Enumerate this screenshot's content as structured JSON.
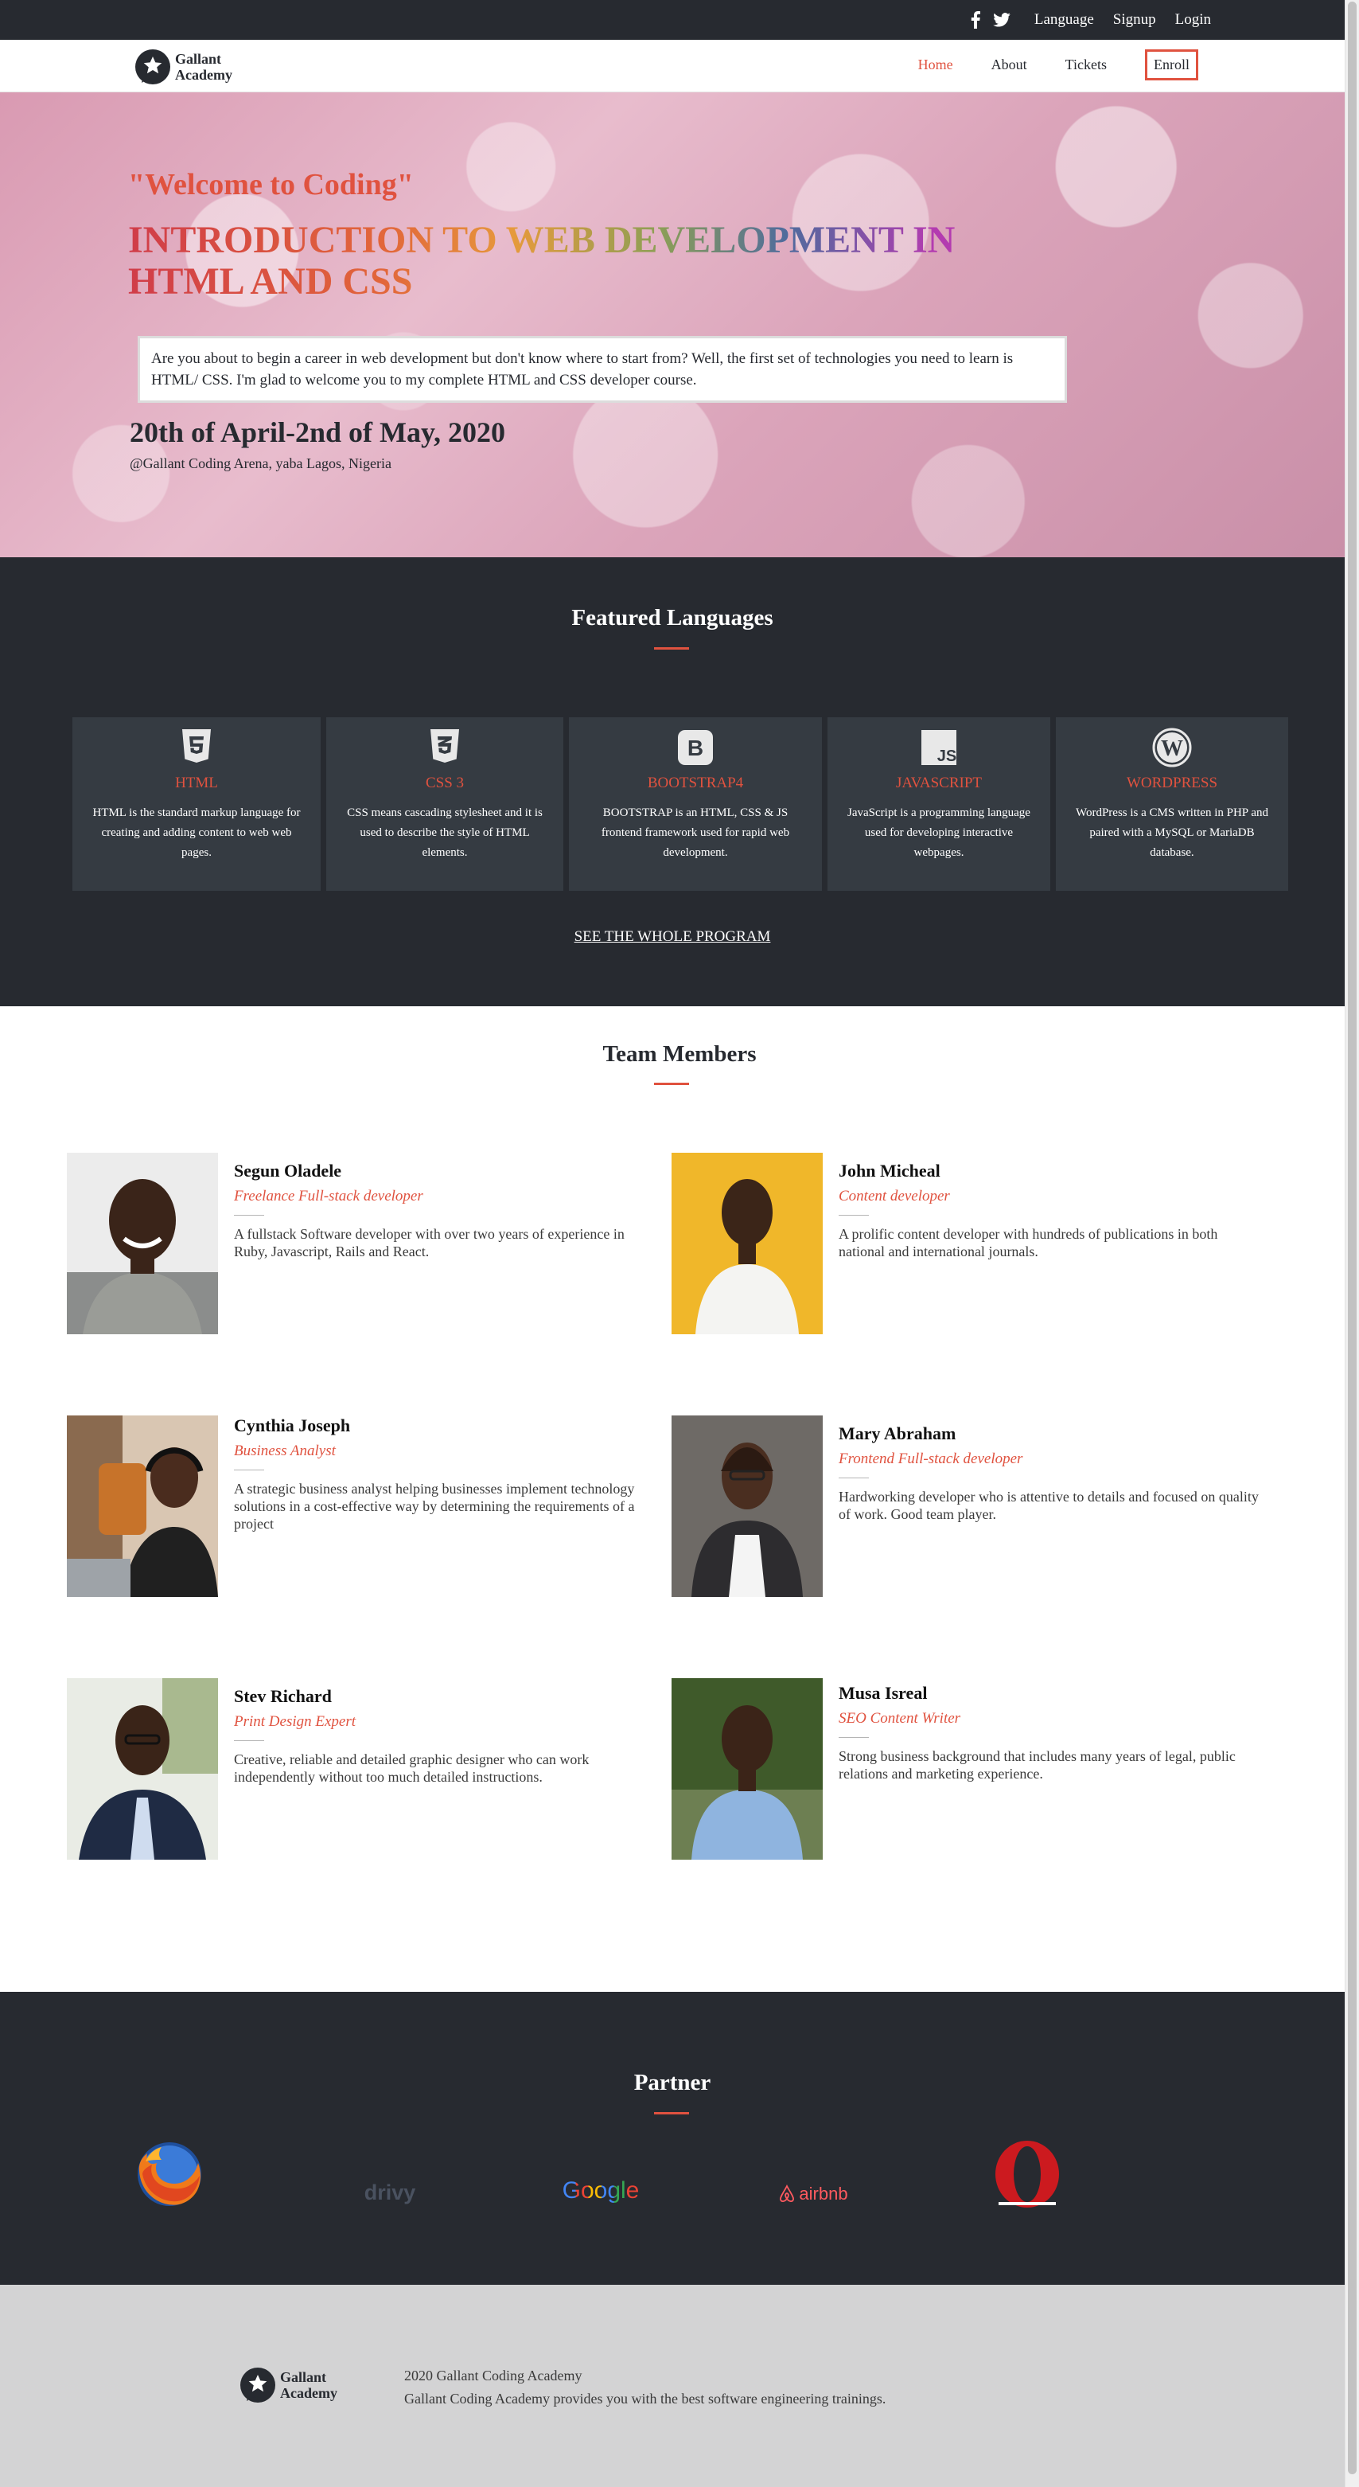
{
  "topbar": {
    "icons": [
      "facebook-icon",
      "twitter-icon"
    ],
    "links": [
      "Language",
      "Signup",
      "Login"
    ]
  },
  "brand": {
    "line1": "Gallant",
    "line2": "Academy"
  },
  "nav": {
    "items": [
      "Home",
      "About",
      "Tickets"
    ],
    "active": "Home",
    "enroll": "Enroll"
  },
  "hero": {
    "welcome": "\"Welcome to Coding\"",
    "headline": "INTRODUCTION TO WEB DEVELOPMENT IN HTML AND CSS",
    "intro": "Are you about to begin a career in web development but don't know where to start from? Well, the first set of technologies you need to learn is HTML/ CSS. I'm glad to welcome you to my complete HTML and CSS developer course.",
    "dates": "20th of April-2nd of May, 2020",
    "venue": "@Gallant Coding Arena, yaba Lagos, Nigeria"
  },
  "featured": {
    "title": "Featured Languages",
    "cards": [
      {
        "icon": "html5-icon",
        "name": "HTML",
        "desc": "HTML is the standard markup language for creating and adding content to web web pages."
      },
      {
        "icon": "css3-icon",
        "name": "CSS 3",
        "desc": "CSS means cascading stylesheet and it is used to describe the style of HTML elements."
      },
      {
        "icon": "bootstrap-icon",
        "name": "BOOTSTRAP4",
        "desc": "BOOTSTRAP is an HTML, CSS & JS frontend framework used for rapid web development."
      },
      {
        "icon": "javascript-icon",
        "name": "JAVASCRIPT",
        "desc": "JavaScript is a programming language used for developing interactive webpages."
      },
      {
        "icon": "wordpress-icon",
        "name": "WORDPRESS",
        "desc": "WordPress is a CMS written in PHP and paired with a MySQL or MariaDB database."
      }
    ],
    "cta": "SEE THE WHOLE PROGRAM"
  },
  "team": {
    "title": "Team Members",
    "members": [
      {
        "name": "Segun Oladele",
        "role": "Freelance Full-stack developer",
        "bio": "A fullstack Software developer with over two years of experience in Ruby, Javascript, Rails and React."
      },
      {
        "name": "John Micheal",
        "role": "Content developer",
        "bio": "A prolific content developer with hundreds of publications in both national and international journals."
      },
      {
        "name": "Cynthia Joseph",
        "role": "Business Analyst",
        "bio": "A strategic business analyst helping businesses implement technology solutions in a cost-effective way by determining the requirements of a project"
      },
      {
        "name": "Mary Abraham",
        "role": "Frontend Full-stack developer",
        "bio": "Hardworking developer who is attentive to details and focused on quality of work. Good team player."
      },
      {
        "name": "Stev Richard",
        "role": "Print Design Expert",
        "bio": "Creative, reliable and detailed graphic designer who can work independently without too much detailed instructions."
      },
      {
        "name": "Musa Isreal",
        "role": "SEO Content Writer",
        "bio": "Strong business background that includes many years of legal, public relations and marketing experience."
      }
    ]
  },
  "partner": {
    "title": "Partner",
    "logos": [
      {
        "icon": "firefox-logo",
        "text": ""
      },
      {
        "icon": "drivy-logo",
        "text": "drivy"
      },
      {
        "icon": "google-logo",
        "text": "Google"
      },
      {
        "icon": "airbnb-logo",
        "text": "airbnb"
      },
      {
        "icon": "opera-logo",
        "text": ""
      }
    ]
  },
  "footer": {
    "line1": "2020 Gallant Coding Academy",
    "line2": "Gallant Coding Academy provides you with the best software engineering trainings."
  },
  "colors": {
    "accent": "#e0523f",
    "dark": "#272a30",
    "card": "#353b42",
    "footer": "#d3d3d4"
  }
}
